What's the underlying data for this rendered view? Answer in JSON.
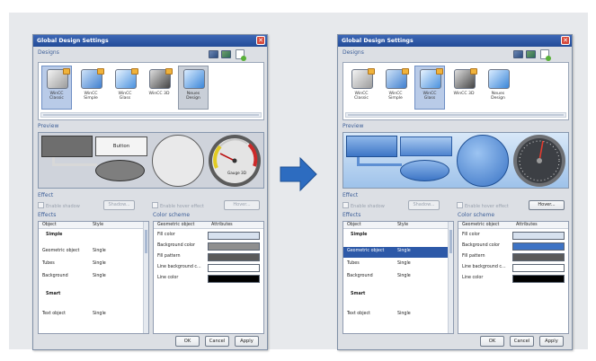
{
  "dialog_title": "Global Design Settings",
  "close_glyph": "✕",
  "sections": {
    "designs": "Designs",
    "preview": "Preview",
    "effect": "Effect",
    "effects": "Effects",
    "color_scheme": "Color scheme"
  },
  "designs": [
    {
      "name": "WinCC\nClassic"
    },
    {
      "name": "WinCC\nSimple"
    },
    {
      "name": "WinCC\nGlass"
    },
    {
      "name": "WinCC 3D"
    },
    {
      "name": "Neues\nDesign"
    }
  ],
  "preview": {
    "button_label": "Button",
    "gauge_label": "Gauge 3D"
  },
  "effect": {
    "enable_shadow": "Enable shadow",
    "shadow_button": "Shadow...",
    "enable_hover": "Enable hover effect",
    "hover_button": "Hover..."
  },
  "effects_table": {
    "headers": [
      "Object",
      "Style"
    ],
    "rows": [
      {
        "object": "Simple",
        "style": "",
        "group": true
      },
      {
        "object": "Geometric object",
        "style": "Single"
      },
      {
        "object": "Tubes",
        "style": "Single"
      },
      {
        "object": "Background",
        "style": "Single"
      },
      {
        "object": "Smart",
        "style": "",
        "group": true
      },
      {
        "object": "Text object",
        "style": "Single"
      }
    ]
  },
  "color_table": {
    "headers": [
      "Geometric object",
      "Attributes"
    ],
    "rows": [
      {
        "label": "Fill color"
      },
      {
        "label": "Background color"
      },
      {
        "label": "Fill pattern"
      },
      {
        "label": "Line background c..."
      },
      {
        "label": "Line color"
      }
    ]
  },
  "buttons": {
    "ok": "OK",
    "cancel": "Cancel",
    "apply": "Apply"
  },
  "colors": {
    "left_swatches": [
      "#d7e1ee",
      "#8f8f8f",
      "#5a5a5a",
      "#ffffff",
      "#000000"
    ],
    "right_swatches": [
      "#d7e1ee",
      "#3e73c4",
      "#5a5a5a",
      "#ffffff",
      "#000000"
    ],
    "arrow": "#2d6cc0"
  },
  "state": {
    "left_selected_design": "WinCC Classic",
    "right_selected_design": "WinCC Glass",
    "right_selected_effect_row": "Geometric object"
  }
}
